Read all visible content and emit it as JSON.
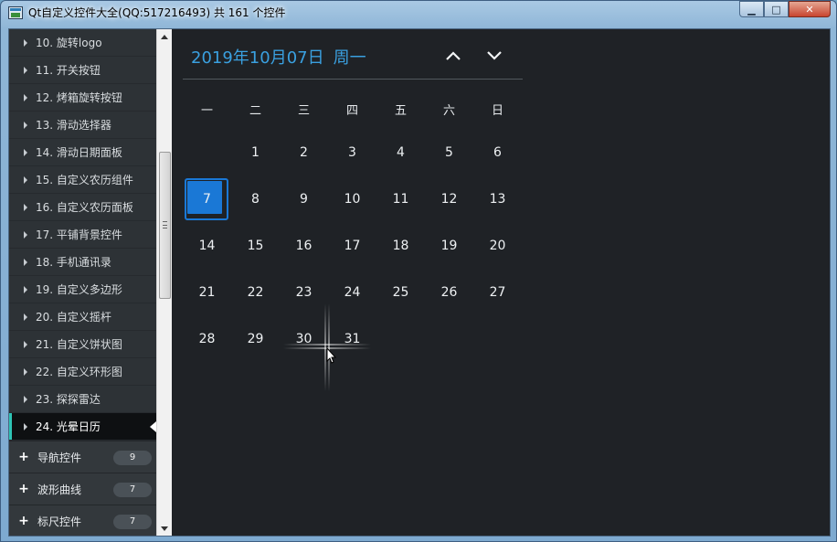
{
  "window": {
    "title": "Qt自定义控件大全(QQ:517216493) 共 161 个控件",
    "buttons": {
      "minimize": "▁",
      "maximize": "□",
      "close": "✕"
    }
  },
  "sidebar": {
    "items": [
      {
        "label": "10. 旋转logo",
        "active": false
      },
      {
        "label": "11. 开关按钮",
        "active": false
      },
      {
        "label": "12. 烤箱旋转按钮",
        "active": false
      },
      {
        "label": "13. 滑动选择器",
        "active": false
      },
      {
        "label": "14. 滑动日期面板",
        "active": false
      },
      {
        "label": "15. 自定义农历组件",
        "active": false
      },
      {
        "label": "16. 自定义农历面板",
        "active": false
      },
      {
        "label": "17. 平铺背景控件",
        "active": false
      },
      {
        "label": "18. 手机通讯录",
        "active": false
      },
      {
        "label": "19. 自定义多边形",
        "active": false
      },
      {
        "label": "20. 自定义摇杆",
        "active": false
      },
      {
        "label": "21. 自定义饼状图",
        "active": false
      },
      {
        "label": "22. 自定义环形图",
        "active": false
      },
      {
        "label": "23. 探探雷达",
        "active": false
      },
      {
        "label": "24. 光晕日历",
        "active": true
      }
    ],
    "groups": [
      {
        "label": "导航控件",
        "count": "9"
      },
      {
        "label": "波形曲线",
        "count": "7"
      },
      {
        "label": "标尺控件",
        "count": "7"
      }
    ]
  },
  "calendar": {
    "date_text": "2019年10月07日",
    "weekday_text": "周一",
    "weekdays": [
      "一",
      "二",
      "三",
      "四",
      "五",
      "六",
      "日"
    ],
    "days": [
      "1",
      "2",
      "3",
      "4",
      "5",
      "6",
      "7",
      "8",
      "9",
      "10",
      "11",
      "12",
      "13",
      "14",
      "15",
      "16",
      "17",
      "18",
      "19",
      "20",
      "21",
      "22",
      "23",
      "24",
      "25",
      "26",
      "27",
      "28",
      "29",
      "30",
      "31"
    ],
    "first_weekday_index": 1,
    "selected_day": "7",
    "accent_color": "#3aa0e0",
    "selected_color": "#1a78d6"
  }
}
